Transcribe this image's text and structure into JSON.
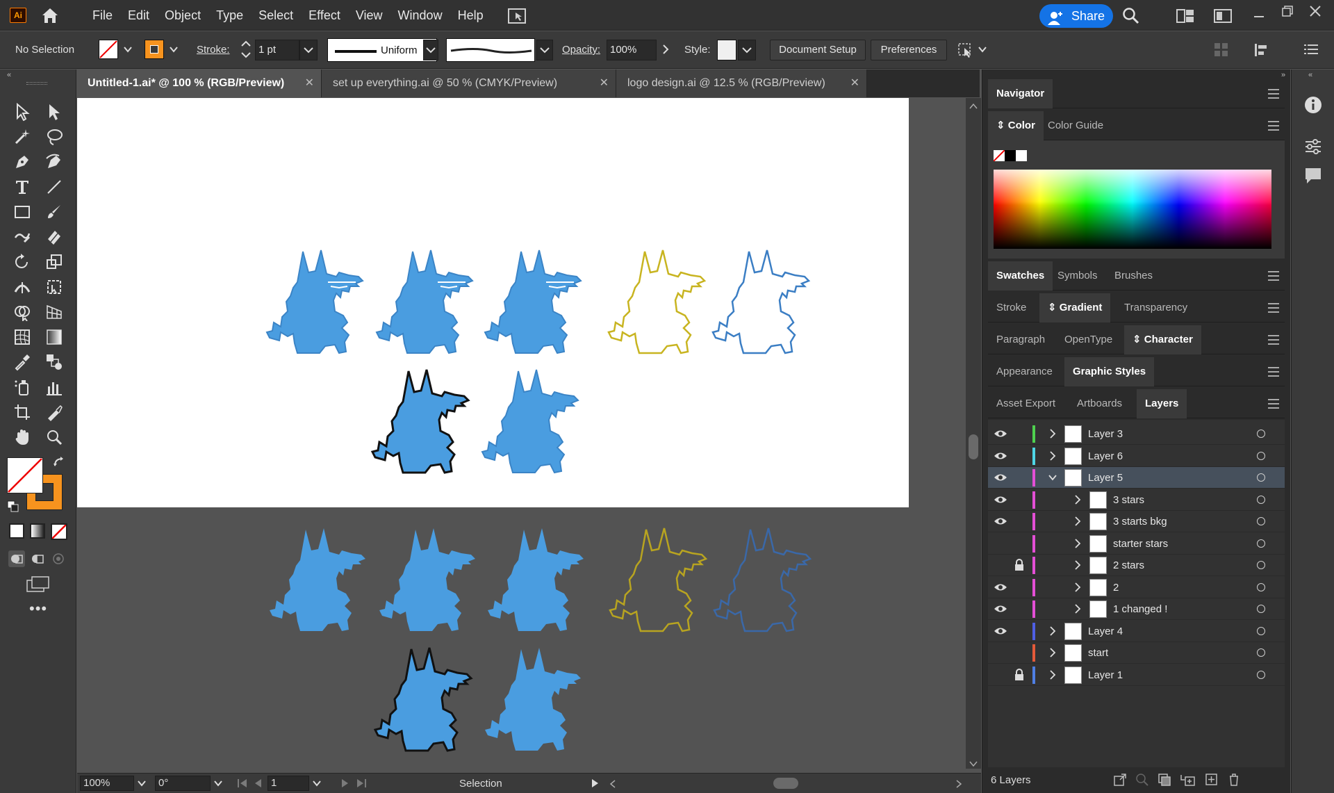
{
  "app": {
    "logo": "Ai",
    "menus": [
      "File",
      "Edit",
      "Object",
      "Type",
      "Select",
      "Effect",
      "View",
      "Window",
      "Help"
    ],
    "share_label": "Share"
  },
  "control": {
    "selection_label": "No Selection",
    "stroke_label": "Stroke:",
    "stroke_weight": "1 pt",
    "stroke_profile": "Uniform",
    "opacity_label": "Opacity:",
    "opacity_value": "100%",
    "style_label": "Style:",
    "document_setup": "Document Setup",
    "preferences": "Preferences",
    "fill_color": "#ffffff",
    "stroke_color": "#f7931e"
  },
  "tabs": [
    {
      "label": "Untitled-1.ai* @ 100 % (RGB/Preview)",
      "active": true
    },
    {
      "label": "set up everything.ai @ 50 % (CMYK/Preview)",
      "active": false
    },
    {
      "label": "logo design.ai @ 12.5 % (RGB/Preview)",
      "active": false
    }
  ],
  "status": {
    "zoom": "100%",
    "rotation": "0°",
    "artboard_number": "1",
    "tool_name": "Selection"
  },
  "panels": {
    "navigator": "Navigator",
    "color": "Color",
    "color_guide": "Color Guide",
    "swatches": "Swatches",
    "symbols": "Symbols",
    "brushes": "Brushes",
    "stroke": "Stroke",
    "gradient": "Gradient",
    "transparency": "Transparency",
    "paragraph": "Paragraph",
    "opentype": "OpenType",
    "character": "Character",
    "appearance": "Appearance",
    "graphic_styles": "Graphic Styles",
    "asset_export": "Asset Export",
    "artboards": "Artboards",
    "layers": "Layers"
  },
  "layers": [
    {
      "name": "Layer 3",
      "visible": true,
      "locked": false,
      "color": "#4fd14f",
      "indent": 0,
      "expanded": false,
      "selected": false
    },
    {
      "name": "Layer 6",
      "visible": true,
      "locked": false,
      "color": "#4fd6e6",
      "indent": 0,
      "expanded": false,
      "selected": false
    },
    {
      "name": "Layer 5",
      "visible": true,
      "locked": false,
      "color": "#e44fd6",
      "indent": 0,
      "expanded": true,
      "selected": true
    },
    {
      "name": "3 stars",
      "visible": true,
      "locked": false,
      "color": "#e44fd6",
      "indent": 1,
      "expanded": false,
      "selected": false
    },
    {
      "name": "3 starts bkg",
      "visible": true,
      "locked": false,
      "color": "#e44fd6",
      "indent": 1,
      "expanded": false,
      "selected": false
    },
    {
      "name": "starter stars",
      "visible": false,
      "locked": false,
      "color": "#e44fd6",
      "indent": 1,
      "expanded": false,
      "selected": false
    },
    {
      "name": "2 stars",
      "visible": false,
      "locked": true,
      "color": "#e44fd6",
      "indent": 1,
      "expanded": false,
      "selected": false
    },
    {
      "name": "2",
      "visible": true,
      "locked": false,
      "color": "#e44fd6",
      "indent": 1,
      "expanded": false,
      "selected": false
    },
    {
      "name": "1 changed !",
      "visible": true,
      "locked": false,
      "color": "#e44fd6",
      "indent": 1,
      "expanded": false,
      "selected": false
    },
    {
      "name": "Layer 4",
      "visible": true,
      "locked": false,
      "color": "#4f5fe4",
      "indent": 0,
      "expanded": false,
      "selected": false
    },
    {
      "name": "start",
      "visible": false,
      "locked": false,
      "color": "#e45a3a",
      "indent": 0,
      "expanded": false,
      "selected": false
    },
    {
      "name": "Layer 1",
      "visible": false,
      "locked": true,
      "color": "#4f7fe4",
      "indent": 0,
      "expanded": false,
      "selected": false
    }
  ],
  "layers_count": "6 Layers",
  "colors": {
    "blue": "#4a9de0",
    "dark_blue": "#3c84c8",
    "mustard": "#c8b420",
    "outline_blue": "#3b7ec4",
    "accent": "#1473e6"
  }
}
